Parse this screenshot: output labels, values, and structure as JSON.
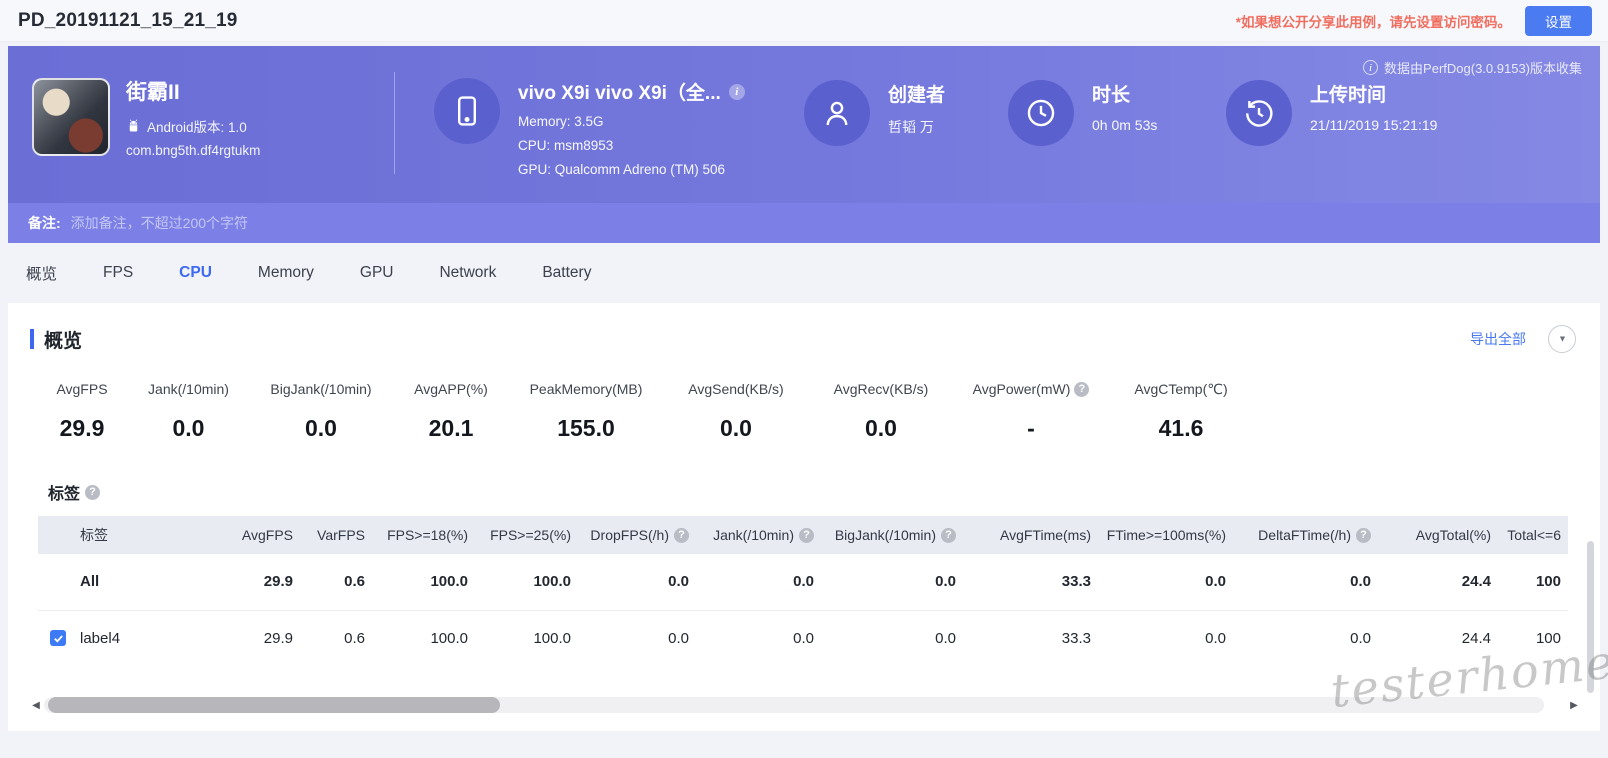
{
  "topbar": {
    "title": "PD_20191121_15_21_19",
    "notice": "*如果想公开分享此用例，请先设置访问密码。",
    "settings_label": "设置"
  },
  "header": {
    "app": {
      "name": "街霸II",
      "android_label": "Android版本: 1.0",
      "package": "com.bng5th.df4rgtukm"
    },
    "device": {
      "name": "vivo X9i vivo X9i（全...",
      "memory": "Memory: 3.5G",
      "cpu": "CPU: msm8953",
      "gpu": "GPU: Qualcomm Adreno (TM) 506"
    },
    "creator": {
      "label": "创建者",
      "value": "哲韬 万"
    },
    "duration": {
      "label": "时长",
      "value": "0h 0m 53s"
    },
    "upload": {
      "label": "上传时间",
      "value": "21/11/2019 15:21:19"
    },
    "collect_info": "数据由PerfDog(3.0.9153)版本收集"
  },
  "remark": {
    "label": "备注:",
    "placeholder": "添加备注，不超过200个字符"
  },
  "tabs": {
    "items": [
      "概览",
      "FPS",
      "CPU",
      "Memory",
      "GPU",
      "Network",
      "Battery"
    ],
    "active": "CPU"
  },
  "overview": {
    "title": "概览",
    "export_label": "导出全部",
    "stats": [
      {
        "label": "AvgFPS",
        "value": "29.9"
      },
      {
        "label": "Jank(/10min)",
        "value": "0.0"
      },
      {
        "label": "BigJank(/10min)",
        "value": "0.0"
      },
      {
        "label": "AvgAPP(%)",
        "value": "20.1"
      },
      {
        "label": "PeakMemory(MB)",
        "value": "155.0"
      },
      {
        "label": "AvgSend(KB/s)",
        "value": "0.0"
      },
      {
        "label": "AvgRecv(KB/s)",
        "value": "0.0"
      },
      {
        "label": "AvgPower(mW)",
        "value": "-"
      },
      {
        "label": "AvgCTemp(℃)",
        "value": "41.6"
      }
    ]
  },
  "labels_section": {
    "title": "标签",
    "table": {
      "columns": [
        {
          "label": "标签"
        },
        {
          "label": "AvgFPS"
        },
        {
          "label": "VarFPS"
        },
        {
          "label": "FPS>=18(%)"
        },
        {
          "label": "FPS>=25(%)"
        },
        {
          "label": "DropFPS(/h)"
        },
        {
          "label": "Jank(/10min)"
        },
        {
          "label": "BigJank(/10min)"
        },
        {
          "label": "AvgFTime(ms)"
        },
        {
          "label": "FTime>=100ms(%)"
        },
        {
          "label": "DeltaFTime(/h)"
        },
        {
          "label": "AvgTotal(%)"
        },
        {
          "label": "Total<=6"
        }
      ],
      "rows": [
        {
          "name": "All",
          "values": [
            "29.9",
            "0.6",
            "100.0",
            "100.0",
            "0.0",
            "0.0",
            "0.0",
            "33.3",
            "0.0",
            "0.0",
            "24.4",
            "100"
          ]
        },
        {
          "name": "label4",
          "values": [
            "29.9",
            "0.6",
            "100.0",
            "100.0",
            "0.0",
            "0.0",
            "0.0",
            "33.3",
            "0.0",
            "0.0",
            "24.4",
            "100"
          ]
        }
      ]
    }
  },
  "watermark": "testerhome.com"
}
